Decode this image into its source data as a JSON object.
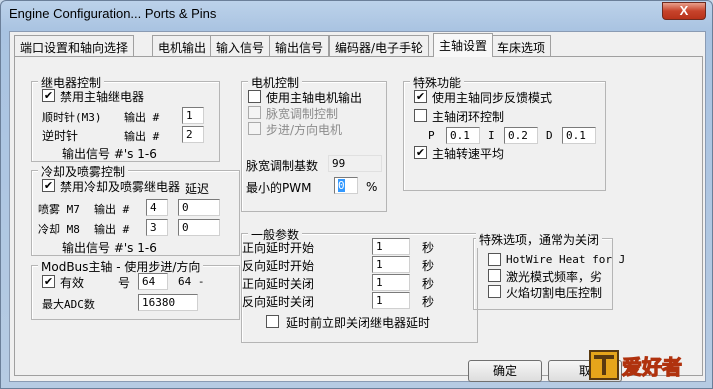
{
  "window": {
    "title": "Engine Configuration... Ports & Pins",
    "close": "X"
  },
  "tabs": [
    "端口设置和轴向选择",
    "电机输出",
    "输入信号",
    "输出信号",
    "编码器/电子手轮",
    "主轴设置",
    "车床选项"
  ],
  "relay": {
    "legend": "继电器控制",
    "enable": "禁用主轴继电器",
    "cw_label": "顺时针(M3)",
    "ccw_label": "逆时针",
    "out_label": "输出 #",
    "cw_val": "1",
    "ccw_val": "2",
    "note": "输出信号 #'s 1-6"
  },
  "coolant": {
    "legend": "冷却及喷雾控制",
    "enable": "禁用冷却及喷雾继电器",
    "delay": "延迟",
    "mist_label": "喷雾 M7",
    "flood_label": "冷却 M8",
    "out_label": "输出 #",
    "mist_val": "4",
    "flood_val": "3",
    "mist_delay": "0",
    "flood_delay": "0",
    "note": "输出信号 #'s 1-6"
  },
  "modbus": {
    "legend": "ModBus主轴 - 使用步进/方向",
    "enabled": "有效",
    "reg_label": "号",
    "reg_val": "64",
    "reg_suffix": "64 -",
    "adc_label": "最大ADC数",
    "adc_val": "16380"
  },
  "motor": {
    "legend": "电机控制",
    "use_output": "使用主轴电机输出",
    "pwm": "脉宽调制控制",
    "stepdir": "步进/方向电机",
    "pwm_base_label": "脉宽调制基数",
    "pwm_base_val": "99",
    "min_pwm_label": "最小的PWM",
    "min_pwm_val": "0",
    "pct": "%"
  },
  "general": {
    "legend": "一般参数",
    "rows": [
      {
        "label": "正向延时开始",
        "val": "1",
        "unit": "秒"
      },
      {
        "label": "反向延时开始",
        "val": "1",
        "unit": "秒"
      },
      {
        "label": "正向延时关闭",
        "val": "1",
        "unit": "秒"
      },
      {
        "label": "反向延时关闭",
        "val": "1",
        "unit": "秒"
      }
    ],
    "immediate": "延时前立即关闭继电器延时"
  },
  "special": {
    "legend": "特殊功能",
    "sync": "使用主轴同步反馈模式",
    "closed": "主轴闭环控制",
    "p_label": "P",
    "p_val": "0.1",
    "i_label": "I",
    "i_val": "0.2",
    "d_label": "D",
    "d_val": "0.1",
    "avg": "主轴转速平均"
  },
  "options": {
    "legend": "特殊选项，通常为关闭",
    "hotwire": "HotWire Heat for J",
    "laser": "激光模式频率，劣",
    "flame": "火焰切割电压控制"
  },
  "buttons": {
    "ok": "确定",
    "cancel": "取"
  },
  "watermark": {
    "text": "爱好者"
  }
}
